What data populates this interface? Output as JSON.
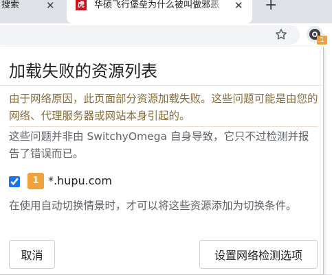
{
  "tabs": {
    "previous": {
      "title": "搜索",
      "close": "✕"
    },
    "active": {
      "favicon": "虎扑",
      "title": "华硕飞行堡垒为什么被叫做邪恶",
      "close": "✕"
    },
    "new_tab": "+"
  },
  "toolbar": {
    "bookmark_icon": "star-icon",
    "extension_icon": "switchyomega-icon",
    "extension_badge": "1"
  },
  "popup": {
    "title": "加载失败的资源列表",
    "warning": "由于网络原因，此页面部分资源加载失败。这些问题可能是由您的网络、代理服务器或网站本身引起的。",
    "info": "这些问题并非由 SwitchyOmega 自身导致，它只不过检测并报告了错误而已。",
    "resources": [
      {
        "checked": true,
        "count": "1",
        "domain": "*.hupu.com"
      }
    ],
    "hint": "在使用自动切换情景时，才可以将这些资源添加为切换条件。",
    "cancel_label": "取消",
    "settings_label": "设置网络检测选项"
  },
  "colors": {
    "warning_text": "#8a6d3b",
    "badge": "#f0a13b",
    "favicon": "#c4161c"
  }
}
